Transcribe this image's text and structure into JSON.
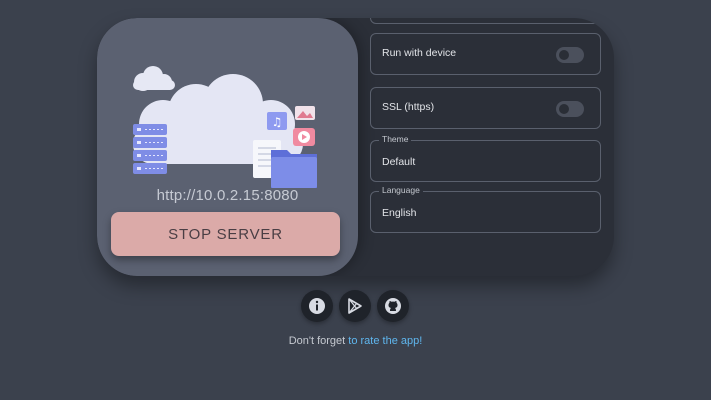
{
  "server": {
    "url": "http://10.0.2.15:8080",
    "stop_label": "STOP SERVER"
  },
  "settings": {
    "run_with_device": {
      "label": "Run with device",
      "enabled": false
    },
    "ssl": {
      "label": "SSL (https)",
      "enabled": false
    },
    "theme": {
      "legend": "Theme",
      "value": "Default"
    },
    "language": {
      "legend": "Language",
      "value": "English"
    }
  },
  "links": {
    "info_icon": "info-icon",
    "play_store_icon": "play-store-icon",
    "github_icon": "github-icon"
  },
  "footer": {
    "prefix": "Don't forget ",
    "link_text": "to rate the app!"
  },
  "colors": {
    "background": "#3b414d",
    "card": "#2b2f38",
    "left_panel": "#5b6171",
    "stop_button": "#dbaaa8",
    "link": "#5fb6ee"
  }
}
